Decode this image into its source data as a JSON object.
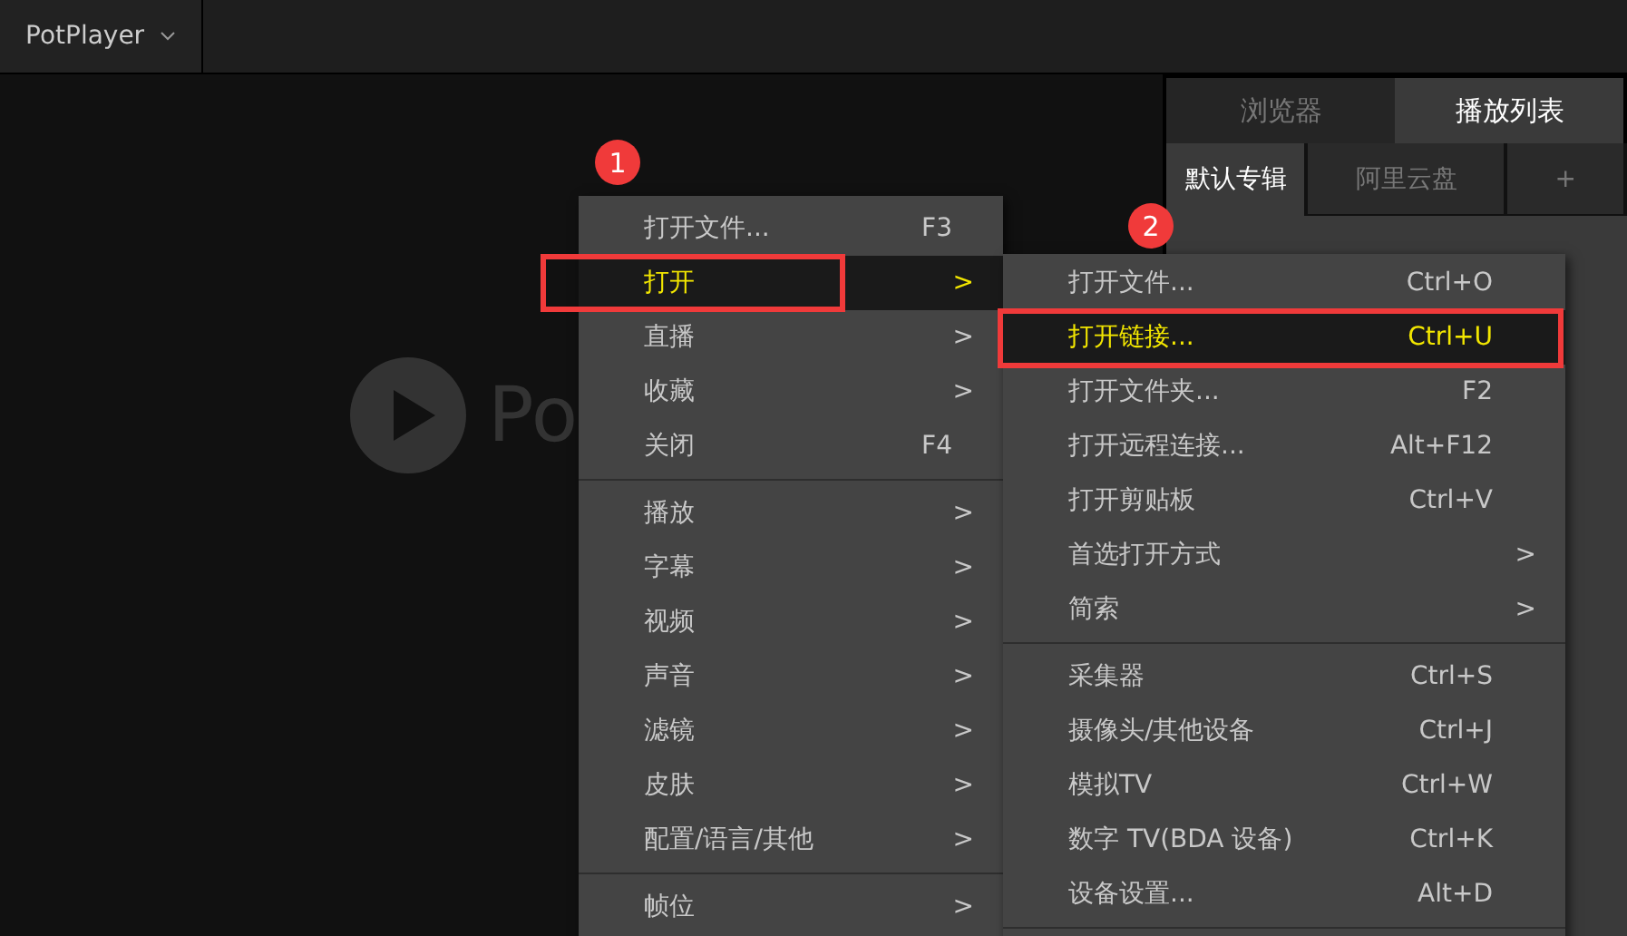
{
  "app_menu": {
    "label": "PotPlayer"
  },
  "player": {
    "logo_text": "Po"
  },
  "panel": {
    "tabs": [
      {
        "label": "浏览器",
        "selected": false
      },
      {
        "label": "播放列表",
        "selected": true
      }
    ],
    "subtabs": [
      {
        "label": "默认专辑",
        "selected": true
      },
      {
        "label": "阿里云盘",
        "selected": false
      },
      {
        "label": "+",
        "selected": false
      }
    ]
  },
  "context_menu": {
    "items": [
      {
        "kind": "item",
        "label": "打开文件...",
        "shortcut": "F3",
        "selected": false
      },
      {
        "kind": "item",
        "label": "打开",
        "arrow": ">",
        "selected": true
      },
      {
        "kind": "item",
        "label": "直播",
        "arrow": ">",
        "selected": false
      },
      {
        "kind": "item",
        "label": "收藏",
        "arrow": ">",
        "selected": false
      },
      {
        "kind": "item",
        "label": "关闭",
        "shortcut": "F4",
        "selected": false
      },
      {
        "kind": "separator"
      },
      {
        "kind": "item",
        "label": "播放",
        "arrow": ">",
        "selected": false
      },
      {
        "kind": "item",
        "label": "字幕",
        "arrow": ">",
        "selected": false
      },
      {
        "kind": "item",
        "label": "视频",
        "arrow": ">",
        "selected": false
      },
      {
        "kind": "item",
        "label": "声音",
        "arrow": ">",
        "selected": false
      },
      {
        "kind": "item",
        "label": "滤镜",
        "arrow": ">",
        "selected": false
      },
      {
        "kind": "item",
        "label": "皮肤",
        "arrow": ">",
        "selected": false
      },
      {
        "kind": "item",
        "label": "配置/语言/其他",
        "arrow": ">",
        "selected": false
      },
      {
        "kind": "separator"
      },
      {
        "kind": "item",
        "label": "帧位",
        "arrow": ">",
        "selected": false
      }
    ]
  },
  "submenu": {
    "items": [
      {
        "kind": "item",
        "label": "打开文件...",
        "shortcut": "Ctrl+O",
        "selected": false
      },
      {
        "kind": "item",
        "label": "打开链接...",
        "shortcut": "Ctrl+U",
        "selected": true
      },
      {
        "kind": "item",
        "label": "打开文件夹...",
        "shortcut": "F2",
        "selected": false
      },
      {
        "kind": "item",
        "label": "打开远程连接...",
        "shortcut": "Alt+F12",
        "selected": false
      },
      {
        "kind": "item",
        "label": "打开剪贴板",
        "shortcut": "Ctrl+V",
        "selected": false
      },
      {
        "kind": "item",
        "label": "首选打开方式",
        "arrow": ">",
        "selected": false
      },
      {
        "kind": "item",
        "label": "简索",
        "arrow": ">",
        "selected": false
      },
      {
        "kind": "separator"
      },
      {
        "kind": "item",
        "label": "采集器",
        "shortcut": "Ctrl+S",
        "selected": false
      },
      {
        "kind": "item",
        "label": "摄像头/其他设备",
        "shortcut": "Ctrl+J",
        "selected": false
      },
      {
        "kind": "item",
        "label": "模拟TV",
        "shortcut": "Ctrl+W",
        "selected": false
      },
      {
        "kind": "item",
        "label": "数字 TV(BDA 设备)",
        "shortcut": "Ctrl+K",
        "selected": false
      },
      {
        "kind": "item",
        "label": "设备设置...",
        "shortcut": "Alt+D",
        "selected": false
      },
      {
        "kind": "separator"
      }
    ]
  },
  "annotations": [
    {
      "number": "1"
    },
    {
      "number": "2"
    }
  ]
}
